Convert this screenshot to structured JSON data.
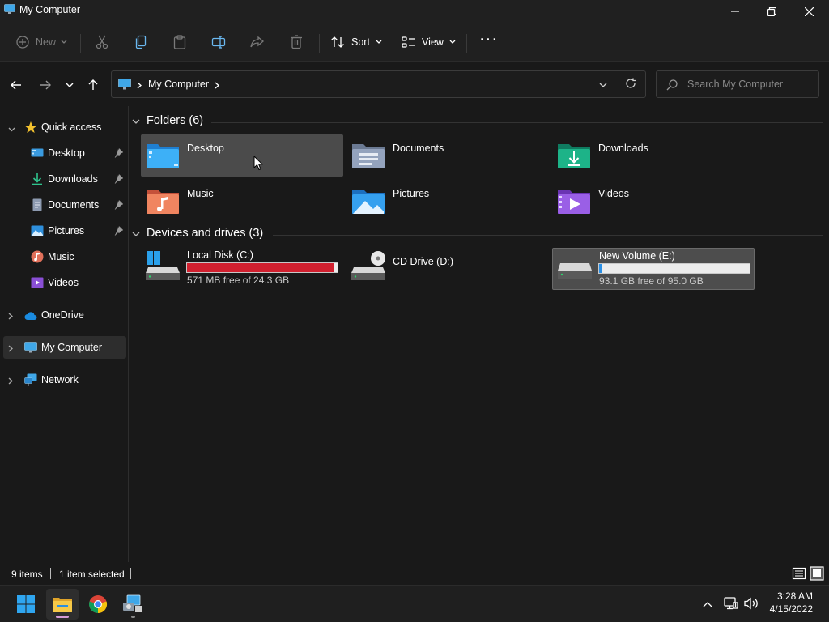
{
  "window": {
    "title": "My Computer",
    "icon": "computer-icon"
  },
  "toolbar": {
    "new_label": "New",
    "sort_label": "Sort",
    "view_label": "View",
    "more_label": "···",
    "icons": [
      "cut-icon",
      "copy-icon",
      "paste-icon",
      "rename-icon",
      "share-icon",
      "delete-icon"
    ]
  },
  "address": {
    "crumb": "My Computer"
  },
  "search": {
    "placeholder": "Search My Computer"
  },
  "sidebar": {
    "quick_access": "Quick access",
    "items": [
      {
        "label": "Desktop",
        "icon": "desktop-icon",
        "pinned": true
      },
      {
        "label": "Downloads",
        "icon": "download-icon",
        "pinned": true
      },
      {
        "label": "Documents",
        "icon": "document-icon",
        "pinned": true
      },
      {
        "label": "Pictures",
        "icon": "pictures-icon",
        "pinned": true
      },
      {
        "label": "Music",
        "icon": "music-icon",
        "pinned": false
      },
      {
        "label": "Videos",
        "icon": "videos-icon",
        "pinned": false
      }
    ],
    "onedrive": "OneDrive",
    "my_computer": "My Computer",
    "network": "Network"
  },
  "content": {
    "folders_header": "Folders (6)",
    "folders": [
      {
        "name": "Desktop",
        "icon": "desktop-folder-icon",
        "color": "#2c9be8"
      },
      {
        "name": "Documents",
        "icon": "documents-folder-icon",
        "color": "#8f9db7"
      },
      {
        "name": "Downloads",
        "icon": "downloads-folder-icon",
        "color": "#19a37f"
      },
      {
        "name": "Music",
        "icon": "music-folder-icon",
        "color": "#e8734a"
      },
      {
        "name": "Pictures",
        "icon": "pictures-folder-icon",
        "color": "#2b8fe0"
      },
      {
        "name": "Videos",
        "icon": "videos-folder-icon",
        "color": "#8b4fd6"
      }
    ],
    "drives_header": "Devices and drives (3)",
    "drives": [
      {
        "name": "Local Disk (C:)",
        "free": "571 MB free of 24.3 GB",
        "used_fraction": 0.977,
        "bar_color": "#d1202f",
        "icon": "windows-drive-icon"
      },
      {
        "name": "CD Drive (D:)",
        "free": "",
        "used_fraction": null,
        "icon": "cd-drive-icon"
      },
      {
        "name": "New Volume (E:)",
        "free": "93.1 GB free of 95.0 GB",
        "used_fraction": 0.02,
        "bar_color": "#2a8fe5",
        "icon": "hard-drive-icon"
      }
    ]
  },
  "status": {
    "items": "9 items",
    "selected": "1 item selected"
  },
  "taskbar": {
    "apps": [
      "windows-start-icon",
      "file-explorer-icon",
      "chrome-icon",
      "control-panel-icon"
    ]
  },
  "clock": {
    "time": "3:28 AM",
    "date": "4/15/2022"
  }
}
